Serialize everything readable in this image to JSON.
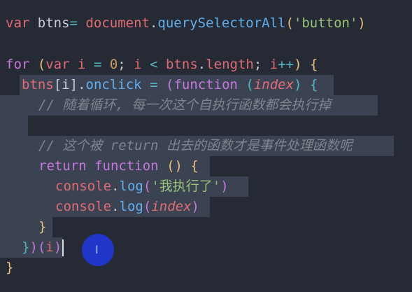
{
  "code": {
    "line1": {
      "kw": "var",
      "name": "btns",
      "eq": "=",
      "obj": "document",
      "dot": ".",
      "method": "querySelectorAll",
      "open": "(",
      "arg": "'button'",
      "close": ")"
    },
    "line3": {
      "kw": "for",
      "open": "(",
      "kw2": "var",
      "i": "i",
      "eq": "=",
      "zero": "0",
      "semi1": ";",
      "i2": "i",
      "lt": "<",
      "arr": "btns",
      "dot": ".",
      "len": "length",
      "semi2": ";",
      "i3": "i",
      "inc": "++",
      "close": ")",
      "brace": "{"
    },
    "line4": {
      "arr": "btns",
      "idx": "[i]",
      "dot": ".",
      "evt": "onclick",
      "eq": "=",
      "p1": "(",
      "fnkw": "function",
      "p2": "(",
      "param": "index",
      "p3": ")",
      "brace": "{"
    },
    "line5": {
      "comment": "// 随着循环, 每一次这个自执行函数都会执行掉"
    },
    "line7": {
      "comment": "// 这个被 return 出去的函数才是事件处理函数呢"
    },
    "line8": {
      "ret": "return",
      "fnkw": "function",
      "parens": "()",
      "brace": "{"
    },
    "line9": {
      "obj": "console",
      "dot": ".",
      "method": "log",
      "open": "(",
      "arg": "'我执行了'",
      "close": ")"
    },
    "line10": {
      "obj": "console",
      "dot": ".",
      "method": "log",
      "open": "(",
      "arg": "index",
      "close": ")"
    },
    "line11": {
      "brace": "}"
    },
    "line12": {
      "brace": "}",
      "p1": ")",
      "p2": "(",
      "arg": "i",
      "p3": ")"
    },
    "line13": {
      "brace": "}"
    }
  },
  "icons": {
    "cursor": "text-cursor-icon",
    "mouse": "ibeam-pointer-icon",
    "ibeam_glyph": "I"
  },
  "colors": {
    "background": "#262a34",
    "selection": "#3b4252",
    "keyword": "#e06c75",
    "control": "#c678dd",
    "function": "#61afef",
    "string": "#98c379",
    "number": "#d19a66",
    "comment": "#7f848e",
    "mouse_highlight": "#1f36c9"
  }
}
